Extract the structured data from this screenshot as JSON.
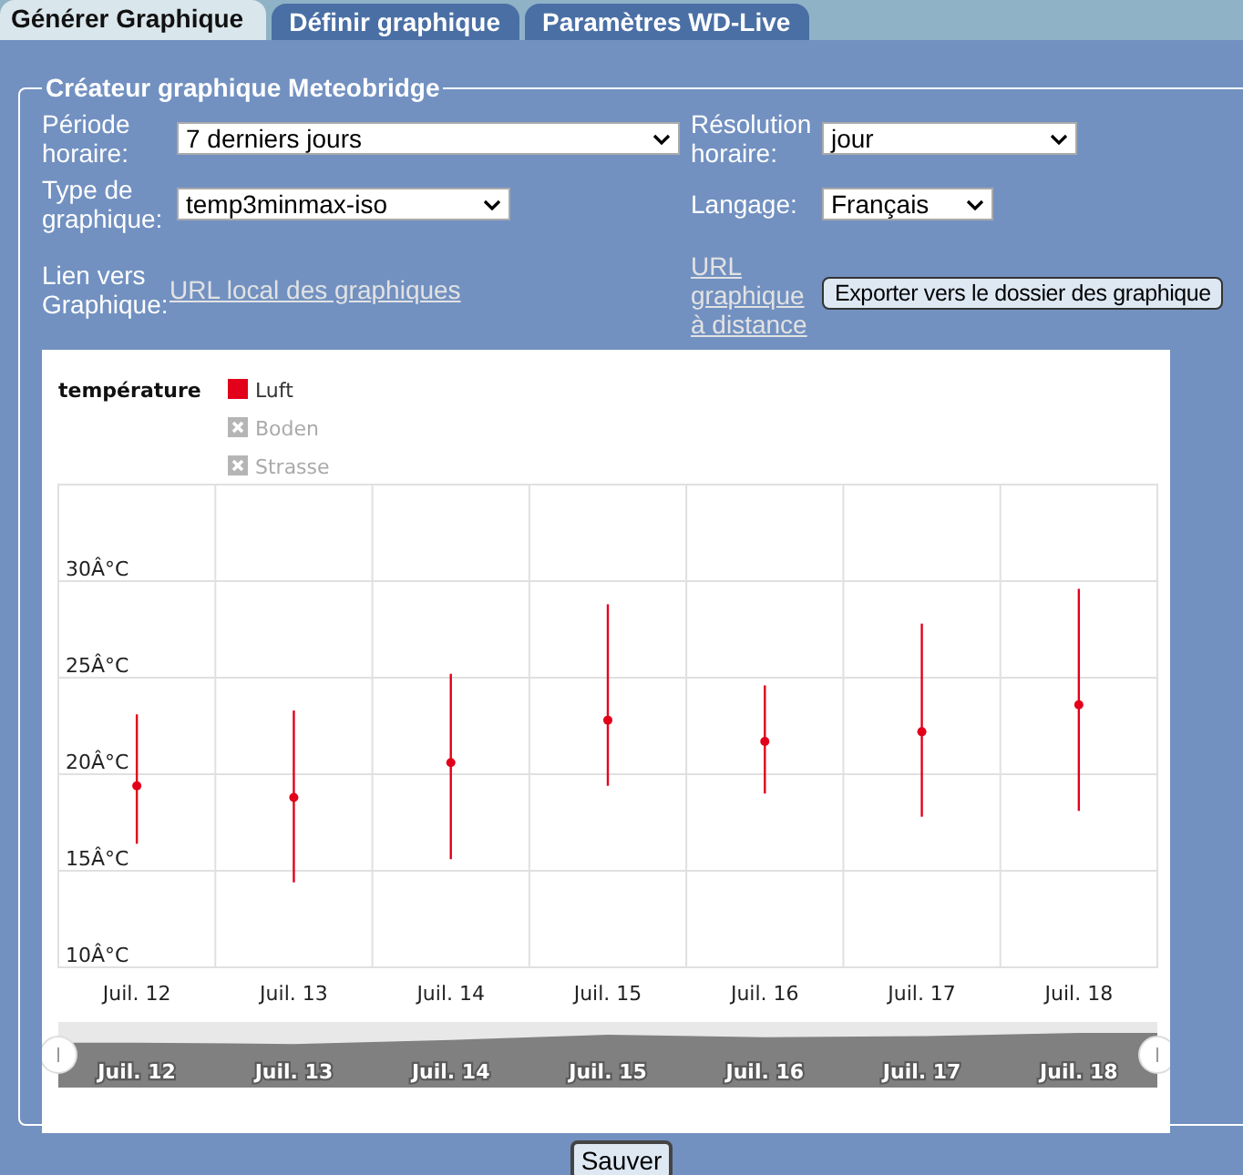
{
  "tabs": [
    {
      "label": "Générer Graphique",
      "selected": true
    },
    {
      "label": "Définir graphique",
      "selected": false
    },
    {
      "label": "Paramètres WD-Live",
      "selected": false
    }
  ],
  "panel": {
    "title": "Créateur graphique Meteobridge",
    "fields": [
      {
        "label": "Période horaire:",
        "value": "7 derniers jours"
      },
      {
        "label": "Résolution horaire:",
        "value": "jour"
      },
      {
        "label": "Type de graphique:",
        "value": "temp3minmax-iso"
      },
      {
        "label": "Langage:",
        "value": "Français"
      }
    ],
    "link_label": "Lien vers Graphique:",
    "local_link": "URL local des graphiques",
    "remote_link": "URL graphique à distance",
    "export_button": "Exporter vers le dossier des graphique",
    "chart": {
      "legend_title": "température",
      "legend": [
        {
          "label": "Boden",
          "enabled": false
        },
        {
          "label": "Strasse",
          "enabled": false
        }
      ],
      "chart_data": {
        "type": "scatter",
        "grid": true,
        "categories": [
          "Juil. 12",
          "Juil. 13",
          "Juil. 14",
          "Juil. 15",
          "Juil. 16",
          "Juil. 17",
          "Juil. 18"
        ],
        "ylim": [
          10,
          35
        ],
        "yticks": [
          {
            "value": 10,
            "label": "10Â°C"
          },
          {
            "value": 15,
            "label": "15Â°C"
          },
          {
            "value": 20,
            "label": "20Â°C"
          },
          {
            "value": 25,
            "label": "25Â°C"
          },
          {
            "value": 30,
            "label": "30Â°C"
          }
        ],
        "series": [
          {
            "name": "Luft",
            "color": "#e2001a",
            "values": [
              19.4,
              18.8,
              20.6,
              22.8,
              21.7,
              22.2,
              23.6
            ],
            "errors": [
              [
                16.4,
                23.1
              ],
              [
                14.4,
                23.3
              ],
              [
                15.6,
                25.2
              ],
              [
                19.4,
                28.8
              ],
              [
                19.0,
                24.6
              ],
              [
                17.8,
                27.8
              ],
              [
                18.1,
                29.6
              ]
            ]
          }
        ]
      },
      "navigator_labels": [
        "Juil. 12",
        "Juil. 13",
        "Juil. 14",
        "Juil. 15",
        "Juil. 16",
        "Juil. 17",
        "Juil. 18"
      ]
    }
  },
  "save_button": "Sauver"
}
